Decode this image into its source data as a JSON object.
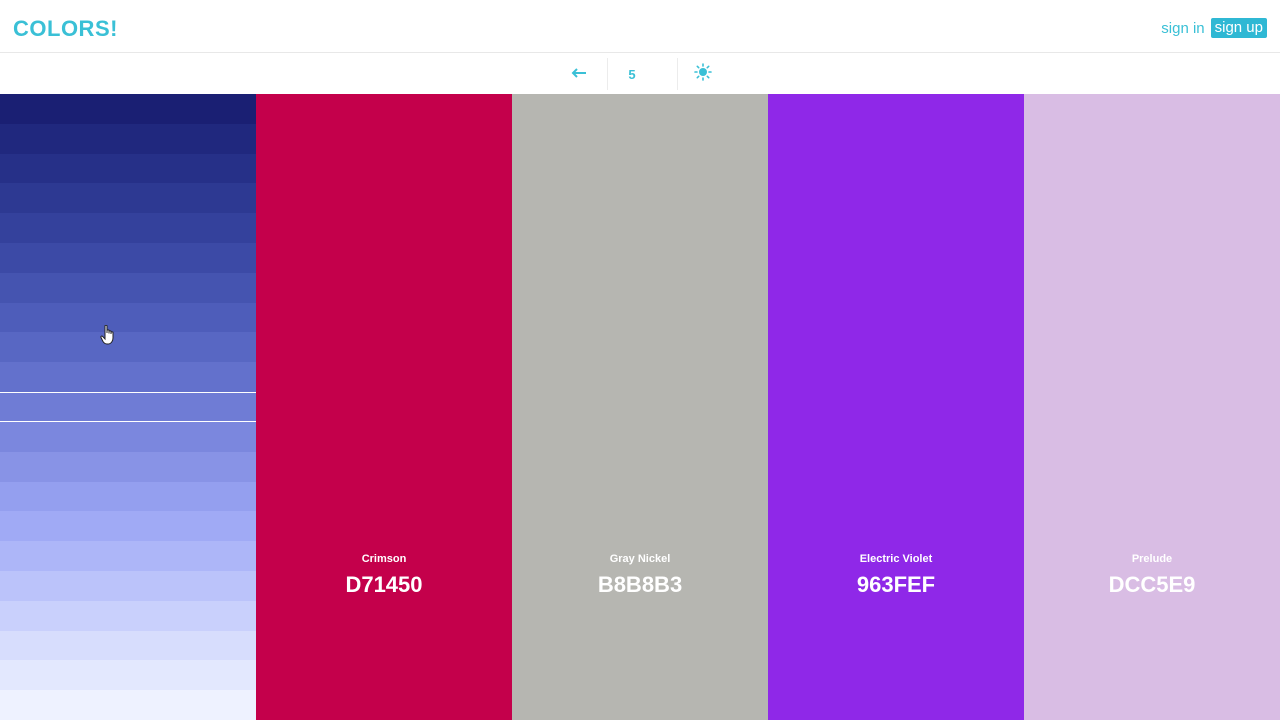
{
  "header": {
    "logo": "COLORS!",
    "sign_in": "sign in",
    "sign_up": "sign up"
  },
  "toolbar": {
    "back_icon": "arrow-left-icon",
    "count": "5",
    "adjust_icon": "sun-icon",
    "accent_color": "#3ac0d6"
  },
  "shades": [
    {
      "color": "#1a1f73"
    },
    {
      "color": "#20287e"
    },
    {
      "color": "#263088"
    },
    {
      "color": "#2d3992"
    },
    {
      "color": "#34419c"
    },
    {
      "color": "#3c4aa6"
    },
    {
      "color": "#4554b0"
    },
    {
      "color": "#4e5dba"
    },
    {
      "color": "#5867c3"
    },
    {
      "color": "#6371cc"
    },
    {
      "color": "#6f7cd5",
      "selected": true
    },
    {
      "color": "#7b87de"
    },
    {
      "color": "#8893e6"
    },
    {
      "color": "#949fef"
    },
    {
      "color": "#a0aaf5"
    },
    {
      "color": "#adb6f8"
    },
    {
      "color": "#bbc3fa"
    },
    {
      "color": "#c9d0fc"
    },
    {
      "color": "#d7ddfd"
    },
    {
      "color": "#e3e8fe"
    },
    {
      "color": "#eef2ff"
    }
  ],
  "swatches": [
    {
      "name": "Crimson",
      "hex": "D71450",
      "color": "#c4004b"
    },
    {
      "name": "Gray Nickel",
      "hex": "B8B8B3",
      "color": "#b6b6b1"
    },
    {
      "name": "Electric Violet",
      "hex": "963FEF",
      "color": "#8f28e8"
    },
    {
      "name": "Prelude",
      "hex": "DCC5E9",
      "color": "#d9bde4"
    }
  ]
}
